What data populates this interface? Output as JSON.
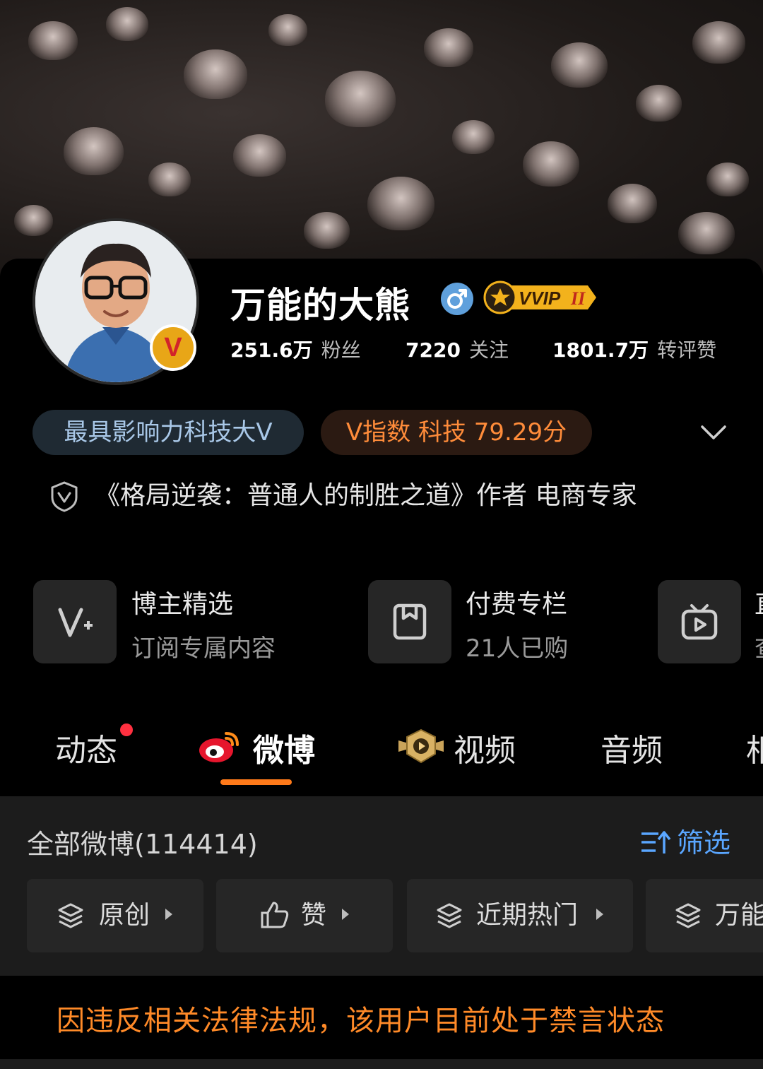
{
  "profile": {
    "name": "万能的大熊",
    "vvip_label": "VVIP",
    "vvip_level": "II",
    "verified_badge": "V",
    "stats": [
      {
        "num": "251.6万",
        "label": "粉丝"
      },
      {
        "num": "7220",
        "label": "关注"
      },
      {
        "num": "1801.7万",
        "label": "转评赞"
      }
    ],
    "tags": [
      "最具影响力科技大V",
      "V指数 科技 79.29分"
    ],
    "bio": "《格局逆袭：普通人的制胜之道》作者 电商专家"
  },
  "cards": [
    {
      "title": "博主精选",
      "subtitle": "订阅专属内容",
      "icon": "v-plus-icon"
    },
    {
      "title": "付费专栏",
      "subtitle": "21人已购",
      "icon": "bookmark-icon"
    },
    {
      "title": "直",
      "subtitle": "查",
      "icon": "tv-icon"
    }
  ],
  "tabs": [
    "动态",
    "微博",
    "视频",
    "音频",
    "相"
  ],
  "feed": {
    "title": "全部微博(114414)",
    "filter_label": "筛选",
    "chips": [
      "原创",
      "赞",
      "近期热门",
      "万能"
    ]
  },
  "notice": "因违反相关法律法规，该用户目前处于禁言状态",
  "colors": {
    "accent": "#ff7a1a",
    "link": "#5aa6ff",
    "notice": "#ff8a28"
  }
}
